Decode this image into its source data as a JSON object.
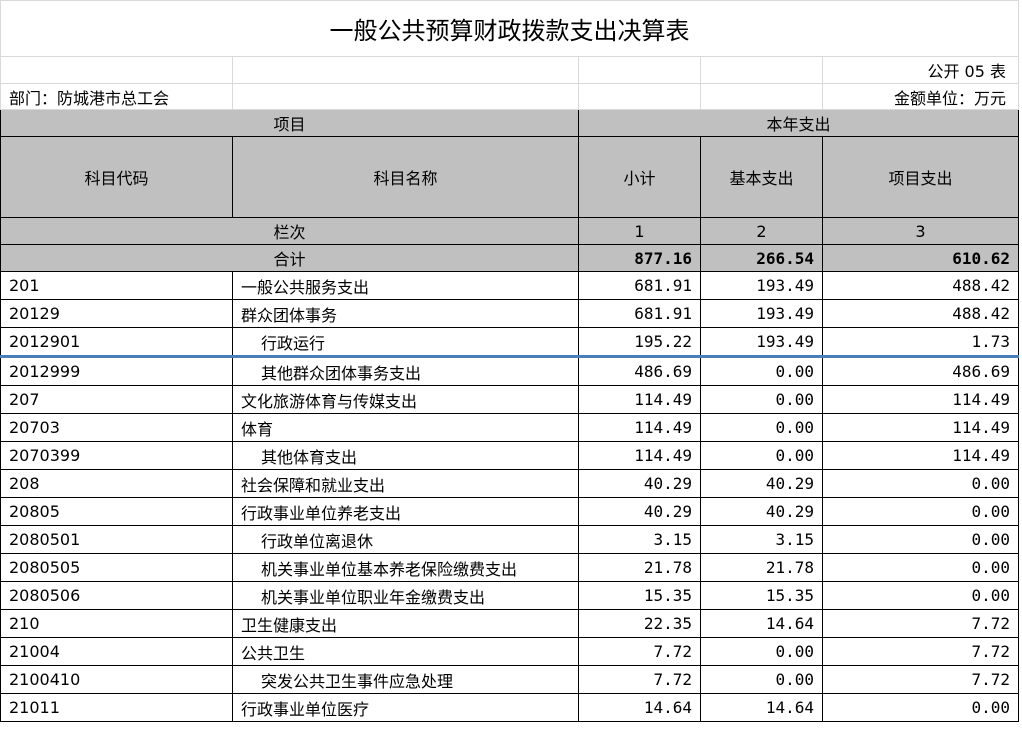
{
  "title": "一般公共预算财政拨款支出决算表",
  "form_no": "公开 05 表",
  "department": "部门：防城港市总工会",
  "unit": "金额单位：万元",
  "header": {
    "project": "项目",
    "current_year": "本年支出",
    "code": "科目代码",
    "name": "科目名称",
    "subtotal": "小计",
    "basic": "基本支出",
    "project_exp": "项目支出",
    "column_no_label": "栏次",
    "col1": "1",
    "col2": "2",
    "col3": "3"
  },
  "total": {
    "label": "合计",
    "subtotal": "877.16",
    "basic": "266.54",
    "project": "610.62"
  },
  "rows": [
    {
      "code": "201",
      "name": "一般公共服务支出",
      "subtotal": "681.91",
      "basic": "193.49",
      "project": "488.42"
    },
    {
      "code": "20129",
      "name": "群众团体事务",
      "subtotal": "681.91",
      "basic": "193.49",
      "project": "488.42"
    },
    {
      "code": "2012901",
      "name": "行政运行",
      "subtotal": "195.22",
      "basic": "193.49",
      "project": "1.73"
    },
    {
      "code": "2012999",
      "name": "其他群众团体事务支出",
      "subtotal": "486.69",
      "basic": "0.00",
      "project": "486.69"
    },
    {
      "code": "207",
      "name": "文化旅游体育与传媒支出",
      "subtotal": "114.49",
      "basic": "0.00",
      "project": "114.49"
    },
    {
      "code": "20703",
      "name": "体育",
      "subtotal": "114.49",
      "basic": "0.00",
      "project": "114.49"
    },
    {
      "code": "2070399",
      "name": "其他体育支出",
      "subtotal": "114.49",
      "basic": "0.00",
      "project": "114.49"
    },
    {
      "code": "208",
      "name": "社会保障和就业支出",
      "subtotal": "40.29",
      "basic": "40.29",
      "project": "0.00"
    },
    {
      "code": "20805",
      "name": "行政事业单位养老支出",
      "subtotal": "40.29",
      "basic": "40.29",
      "project": "0.00"
    },
    {
      "code": "2080501",
      "name": "行政单位离退休",
      "subtotal": "3.15",
      "basic": "3.15",
      "project": "0.00"
    },
    {
      "code": "2080505",
      "name": "机关事业单位基本养老保险缴费支出",
      "subtotal": "21.78",
      "basic": "21.78",
      "project": "0.00"
    },
    {
      "code": "2080506",
      "name": "机关事业单位职业年金缴费支出",
      "subtotal": "15.35",
      "basic": "15.35",
      "project": "0.00"
    },
    {
      "code": "210",
      "name": "卫生健康支出",
      "subtotal": "22.35",
      "basic": "14.64",
      "project": "7.72"
    },
    {
      "code": "21004",
      "name": "公共卫生",
      "subtotal": "7.72",
      "basic": "0.00",
      "project": "7.72"
    },
    {
      "code": "2100410",
      "name": "突发公共卫生事件应急处理",
      "subtotal": "7.72",
      "basic": "0.00",
      "project": "7.72"
    },
    {
      "code": "21011",
      "name": "行政事业单位医疗",
      "subtotal": "14.64",
      "basic": "14.64",
      "project": "0.00"
    }
  ]
}
